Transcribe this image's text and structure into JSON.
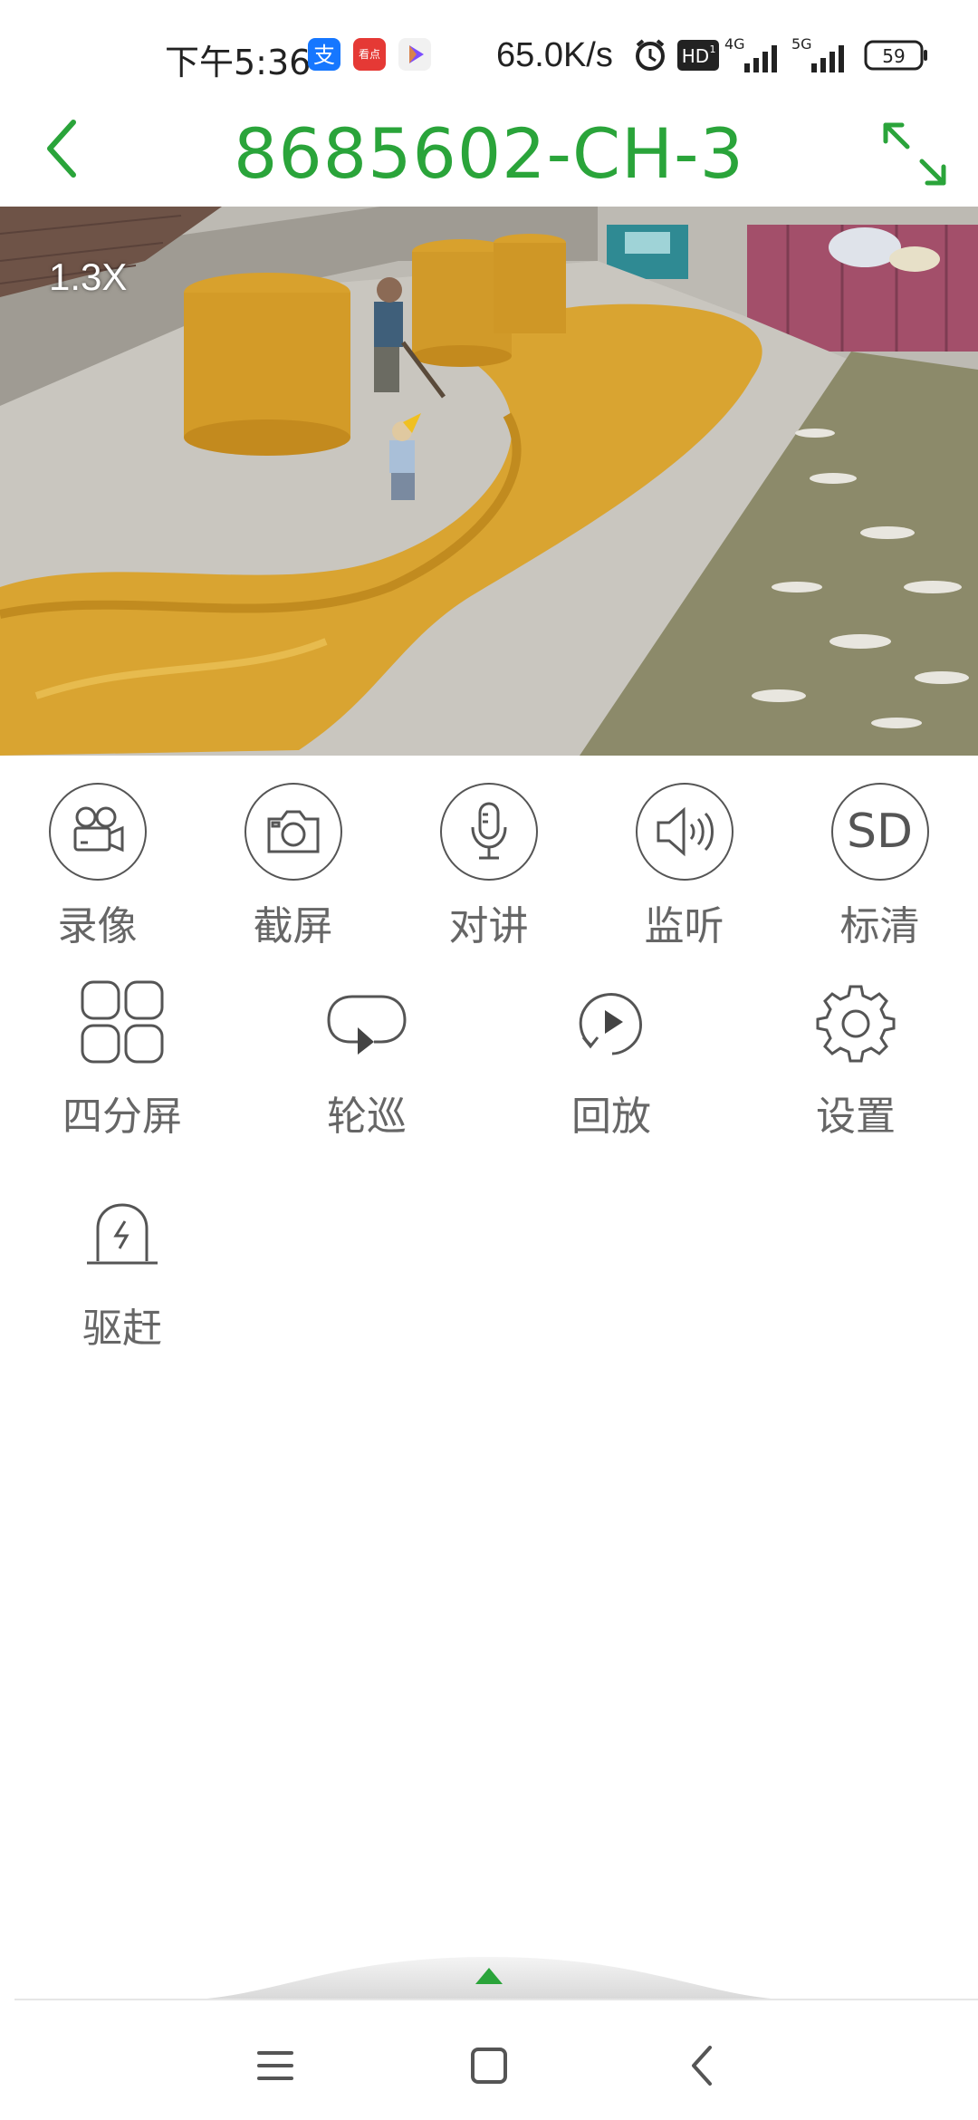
{
  "status_bar": {
    "time": "下午5:36",
    "network_speed": "65.0K/s",
    "battery": "59",
    "icons": [
      "alipay-icon",
      "toutiao-icon",
      "play-store-icon",
      "alarm-icon",
      "hd-icon",
      "signal-4g-icon",
      "signal-5g-icon",
      "battery-icon"
    ],
    "hd_label": "HD",
    "net_4g": "4G",
    "net_5g": "5G"
  },
  "header": {
    "title": "8685602-CH-3",
    "accent_color": "#2aa43a"
  },
  "video": {
    "zoom_label": "1.3X"
  },
  "controls_row1": [
    {
      "label": "录像",
      "icon": "video-camera-icon"
    },
    {
      "label": "截屏",
      "icon": "camera-icon"
    },
    {
      "label": "对讲",
      "icon": "microphone-icon"
    },
    {
      "label": "监听",
      "icon": "speaker-icon"
    },
    {
      "label": "标清",
      "icon": "sd-quality-icon",
      "icon_text": "SD"
    }
  ],
  "controls_row2": [
    {
      "label": "四分屏",
      "icon": "quad-screen-icon"
    },
    {
      "label": "轮巡",
      "icon": "patrol-icon"
    },
    {
      "label": "回放",
      "icon": "playback-icon"
    },
    {
      "label": "设置",
      "icon": "gear-icon"
    }
  ],
  "controls_row3": [
    {
      "label": "驱赶",
      "icon": "alarm-light-icon"
    }
  ],
  "nav": {
    "icons": [
      "menu-icon",
      "home-icon",
      "back-icon"
    ]
  }
}
